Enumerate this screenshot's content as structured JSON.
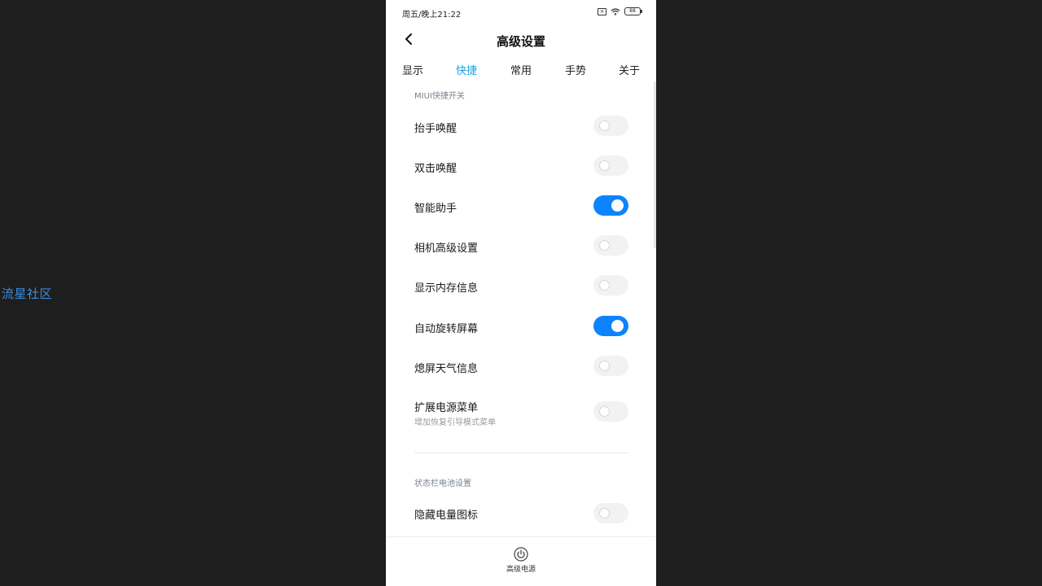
{
  "watermark": "流星社区",
  "status_bar": {
    "time": "周五/晚上21:22",
    "battery": "88",
    "icons": [
      "sim-x-icon",
      "wifi-icon",
      "battery-icon"
    ]
  },
  "header": {
    "title": "高级设置",
    "back_icon": "chevron-left-icon"
  },
  "tabs": [
    {
      "label": "显示",
      "active": false
    },
    {
      "label": "快捷",
      "active": true
    },
    {
      "label": "常用",
      "active": false
    },
    {
      "label": "手势",
      "active": false
    },
    {
      "label": "关于",
      "active": false
    }
  ],
  "sections": [
    {
      "title": "MIUI快捷开关",
      "items": [
        {
          "label": "抬手唤醒",
          "on": false
        },
        {
          "label": "双击唤醒",
          "on": false
        },
        {
          "label": "智能助手",
          "on": true
        },
        {
          "label": "相机高级设置",
          "on": false
        },
        {
          "label": "显示内存信息",
          "on": false
        },
        {
          "label": "自动旋转屏幕",
          "on": true
        },
        {
          "label": "熄屏天气信息",
          "on": false
        },
        {
          "label": "扩展电源菜单",
          "sub": "增加恢复引导模式菜单",
          "on": false
        }
      ]
    },
    {
      "title": "状态栏电池设置",
      "items": [
        {
          "label": "隐藏电量图标",
          "on": false
        }
      ]
    }
  ],
  "bottom_bar": {
    "label": "高级电源",
    "icon": "power-icon"
  },
  "colors": {
    "accent": "#0d84ff",
    "active_tab": "#1aa3e8",
    "watermark": "#3d8ee0",
    "background": "#1e1e1e"
  }
}
